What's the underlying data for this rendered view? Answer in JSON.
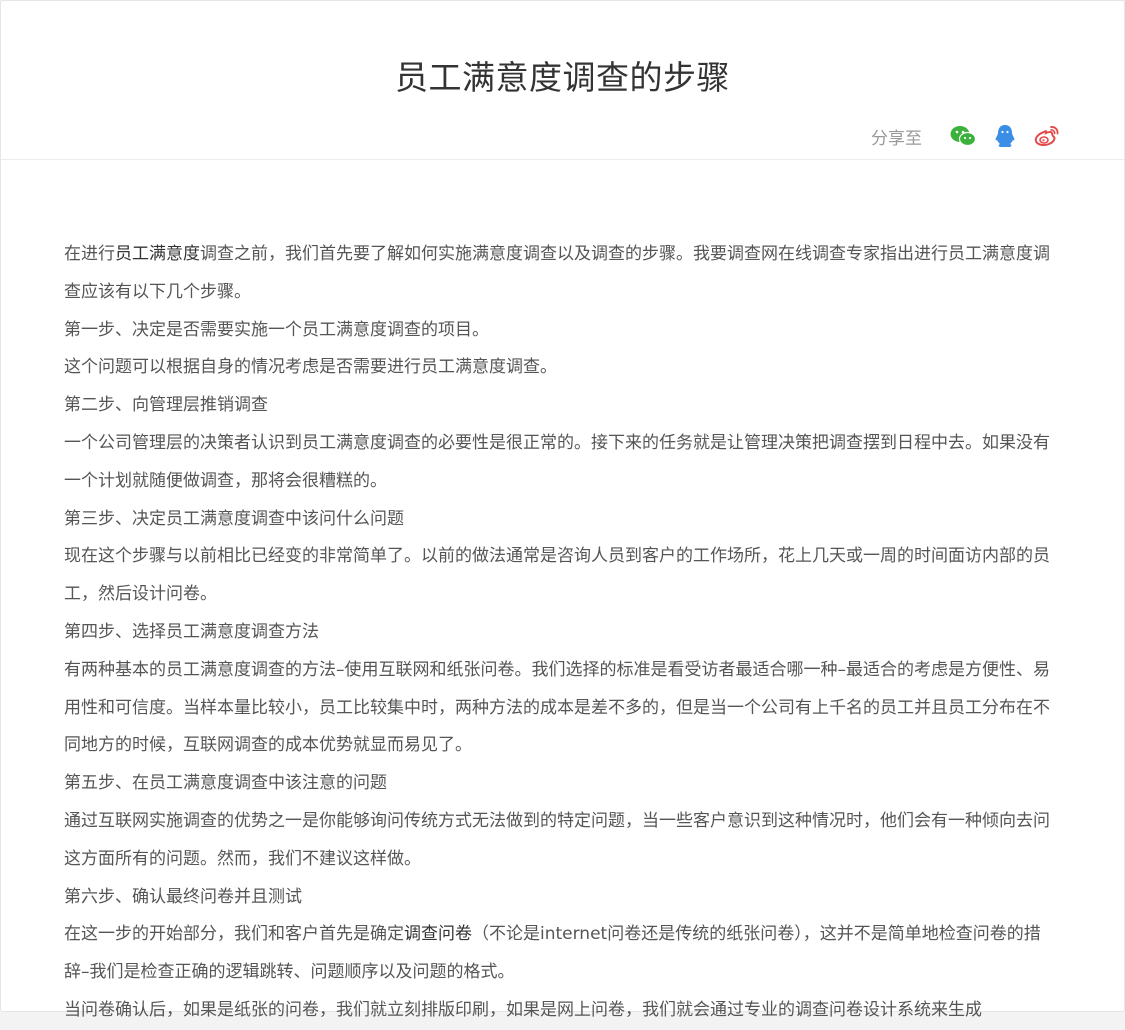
{
  "article": {
    "title": "员工满意度调查的步骤"
  },
  "share": {
    "label": "分享至",
    "icons": [
      "wechat-icon",
      "qq-icon",
      "weibo-icon"
    ],
    "colors": {
      "wechat": "#3bb23b",
      "qq": "#3a8ee6",
      "weibo": "#e34b4b"
    }
  },
  "body": {
    "p1_before": "在进行",
    "p1_link": "员工满意度",
    "p1_after": "调查之前，我们首先要了解如何实施满意度调查以及调查的步骤。我要调查网在线调查专家指出进行员工满意度调查应该有以下几个步骤。",
    "p2": "第一步、决定是否需要实施一个员工满意度调查的项目。",
    "p3": "这个问题可以根据自身的情况考虑是否需要进行员工满意度调查。",
    "p4": "第二步、向管理层推销调查",
    "p5": "一个公司管理层的决策者认识到员工满意度调查的必要性是很正常的。接下来的任务就是让管理决策把调查摆到日程中去。如果没有一个计划就随便做调查，那将会很糟糕的。",
    "p6": "第三步、决定员工满意度调查中该问什么问题",
    "p7": "现在这个步骤与以前相比已经变的非常简单了。以前的做法通常是咨询人员到客户的工作场所，花上几天或一周的时间面访内部的员工，然后设计问卷。",
    "p8": "第四步、选择员工满意度调查方法",
    "p9": "有两种基本的员工满意度调查的方法–使用互联网和纸张问卷。我们选择的标准是看受访者最适合哪一种–最适合的考虑是方便性、易用性和可信度。当样本量比较小，员工比较集中时，两种方法的成本是差不多的，但是当一个公司有上千名的员工并且员工分布在不同地方的时候，互联网调查的成本优势就显而易见了。",
    "p10": "第五步、在员工满意度调查中该注意的问题",
    "p11": "通过互联网实施调查的优势之一是你能够询问传统方式无法做到的特定问题，当一些客户意识到这种情况时，他们会有一种倾向去问这方面所有的问题。然而，我们不建议这样做。",
    "p12": "第六步、确认最终问卷并且测试",
    "p13_before": "在这一步的开始部分，我们和客户首先是确定",
    "p13_link": "调查问卷",
    "p13_after": "（不论是internet问卷还是传统的纸张问卷），这并不是简单地检查问卷的措辞–我们是检查正确的逻辑跳转、问题顺序以及问题的格式。",
    "p14": "当问卷确认后，如果是纸张的问卷，我们就立刻排版印刷，如果是网上问卷，我们就会通过专业的调查问卷设计系统来生成"
  }
}
